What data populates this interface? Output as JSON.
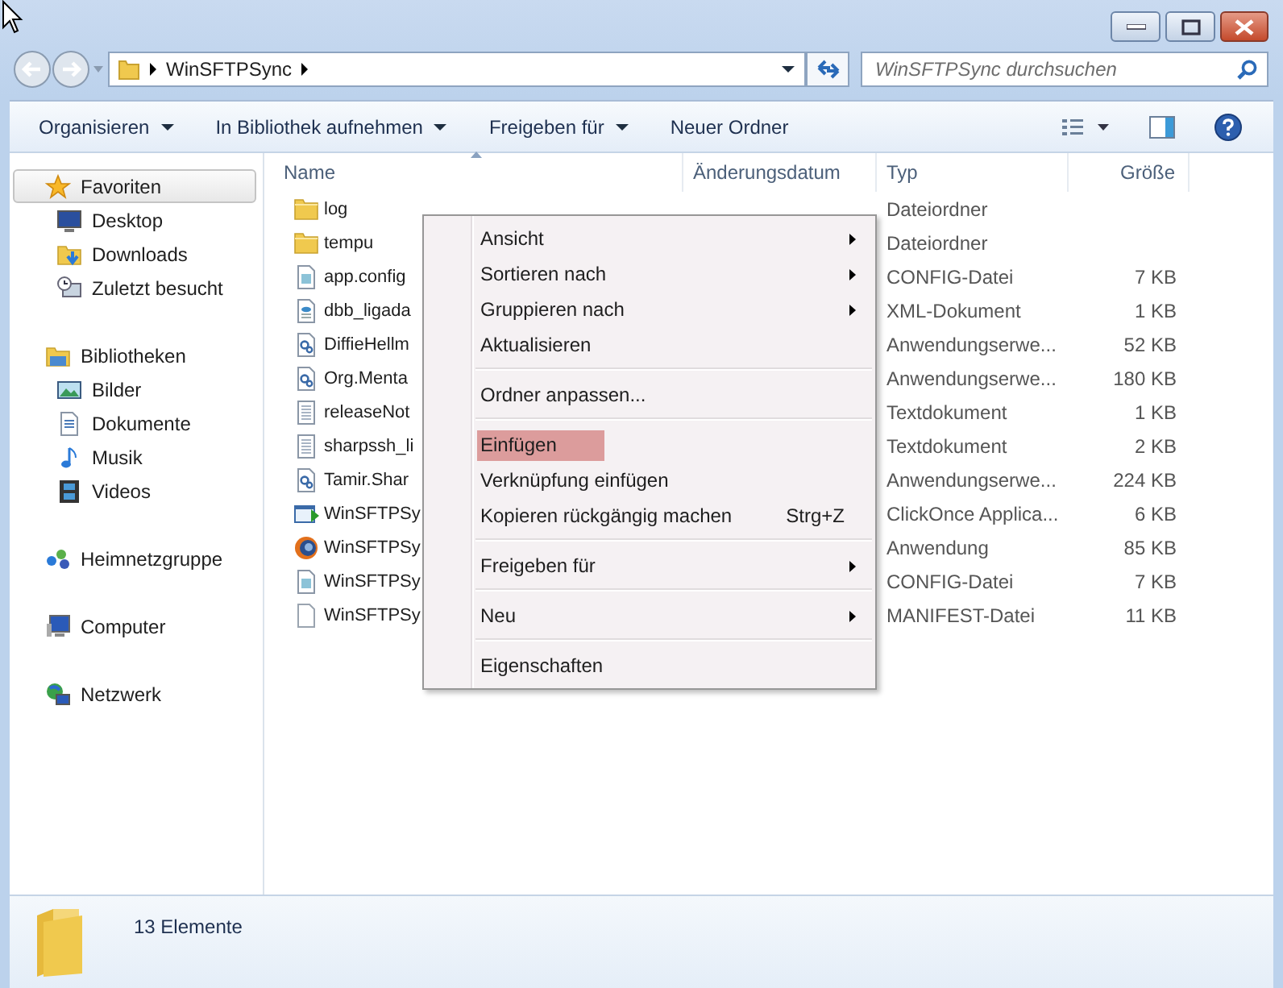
{
  "address_bar": {
    "segments": [
      "WinSFTPSync"
    ]
  },
  "search": {
    "placeholder": "WinSFTPSync durchsuchen"
  },
  "toolbar": {
    "buttons": [
      {
        "label": "Organisieren",
        "dropdown": true
      },
      {
        "label": "In Bibliothek aufnehmen",
        "dropdown": true
      },
      {
        "label": "Freigeben für",
        "dropdown": true
      },
      {
        "label": "Neuer Ordner",
        "dropdown": false
      }
    ]
  },
  "sidebar": {
    "items": [
      {
        "label": "Favoriten",
        "kind": "star",
        "selected": true,
        "children": [
          {
            "label": "Desktop",
            "kind": "desktop",
            "selected": false
          },
          {
            "label": "Downloads",
            "kind": "downloads",
            "selected": false
          },
          {
            "label": "Zuletzt besucht",
            "kind": "recent",
            "selected": false
          }
        ]
      },
      {
        "label": "Bibliotheken",
        "kind": "library",
        "selected": false,
        "children": [
          {
            "label": "Bilder",
            "kind": "pictures",
            "selected": false
          },
          {
            "label": "Dokumente",
            "kind": "documents",
            "selected": false
          },
          {
            "label": "Musik",
            "kind": "music",
            "selected": false
          },
          {
            "label": "Videos",
            "kind": "videos",
            "selected": false
          }
        ]
      },
      {
        "label": "Heimnetzgruppe",
        "kind": "homegroup",
        "selected": false
      },
      {
        "label": "Computer",
        "kind": "computer",
        "selected": false
      },
      {
        "label": "Netzwerk",
        "kind": "network",
        "selected": false
      }
    ]
  },
  "table": {
    "columns": [
      {
        "label": "Name",
        "sorted": true
      },
      {
        "label": "Änderungsdatum",
        "sorted": false
      },
      {
        "label": "Typ",
        "sorted": false
      },
      {
        "label": "Größe",
        "sorted": false
      }
    ],
    "rows": [
      {
        "name": "log",
        "kind": "folder",
        "type": "Dateiordner",
        "size": ""
      },
      {
        "name": "tempu",
        "kind": "folder",
        "type": "Dateiordner",
        "size": ""
      },
      {
        "name": "app.config",
        "kind": "config",
        "type": "CONFIG-Datei",
        "size": "7 KB"
      },
      {
        "name": "dbb_ligada",
        "kind": "xml",
        "type": "XML-Dokument",
        "size": "1 KB"
      },
      {
        "name": "DiffieHellm",
        "kind": "dll",
        "type": "Anwendungserwe...",
        "size": "52 KB"
      },
      {
        "name": "Org.Menta",
        "kind": "dll",
        "type": "Anwendungserwe...",
        "size": "180 KB"
      },
      {
        "name": "releaseNot",
        "kind": "text",
        "type": "Textdokument",
        "size": "1 KB"
      },
      {
        "name": "sharpssh_li",
        "kind": "text",
        "type": "Textdokument",
        "size": "2 KB"
      },
      {
        "name": "Tamir.Shar",
        "kind": "dll",
        "type": "Anwendungserwe...",
        "size": "224 KB"
      },
      {
        "name": "WinSFTPSy",
        "kind": "clickonce",
        "type": "ClickOnce Applica...",
        "size": "6 KB"
      },
      {
        "name": "WinSFTPSy",
        "kind": "app",
        "type": "Anwendung",
        "size": "85 KB"
      },
      {
        "name": "WinSFTPSy",
        "kind": "config",
        "type": "CONFIG-Datei",
        "size": "7 KB"
      },
      {
        "name": "WinSFTPSy",
        "kind": "blank",
        "type": "MANIFEST-Datei",
        "size": "11 KB"
      }
    ]
  },
  "context_menu": {
    "items": [
      {
        "kind": "item",
        "label": "Ansicht",
        "submenu": true,
        "selected": false
      },
      {
        "kind": "item",
        "label": "Sortieren nach",
        "submenu": true,
        "selected": false
      },
      {
        "kind": "item",
        "label": "Gruppieren nach",
        "submenu": true,
        "selected": false
      },
      {
        "kind": "item",
        "label": "Aktualisieren",
        "submenu": false,
        "selected": false
      },
      {
        "kind": "separator"
      },
      {
        "kind": "item",
        "label": "Ordner anpassen...",
        "submenu": false,
        "selected": false
      },
      {
        "kind": "separator"
      },
      {
        "kind": "item",
        "label": "Einfügen",
        "submenu": false,
        "selected": true
      },
      {
        "kind": "item",
        "label": "Verknüpfung einfügen",
        "submenu": false,
        "selected": false
      },
      {
        "kind": "item",
        "label": "Kopieren rückgängig machen",
        "shortcut": "Strg+Z",
        "submenu": false,
        "selected": false
      },
      {
        "kind": "separator"
      },
      {
        "kind": "item",
        "label": "Freigeben für",
        "submenu": true,
        "selected": false
      },
      {
        "kind": "separator"
      },
      {
        "kind": "item",
        "label": "Neu",
        "submenu": true,
        "selected": false
      },
      {
        "kind": "separator"
      },
      {
        "kind": "item",
        "label": "Eigenschaften",
        "submenu": false,
        "selected": false
      }
    ]
  },
  "status_bar": {
    "text": "13 Elemente"
  }
}
